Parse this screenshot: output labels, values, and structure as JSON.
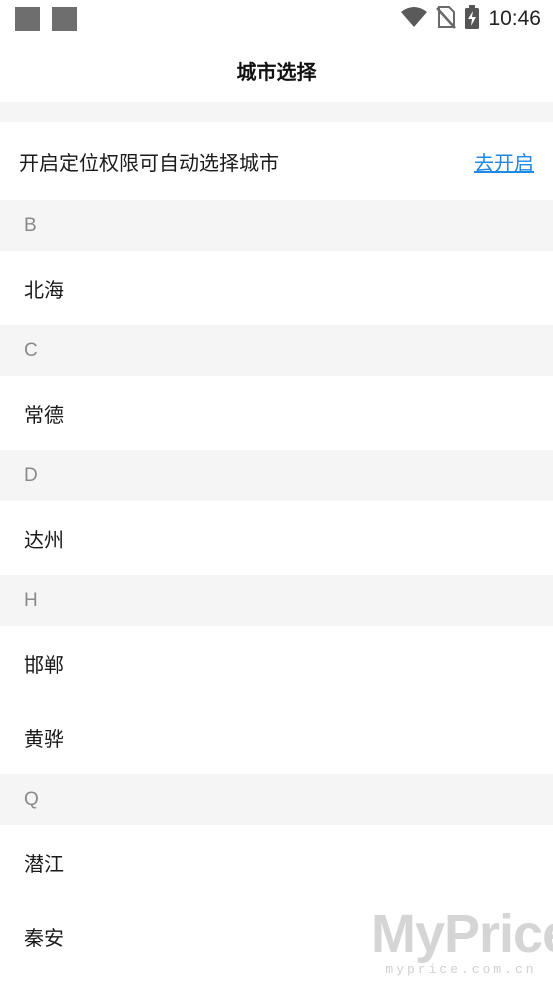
{
  "status_bar": {
    "time": "10:46",
    "icons": [
      "notification-square-icon",
      "notification-square-icon",
      "wifi-icon",
      "no-sim-icon",
      "battery-charging-icon"
    ]
  },
  "header": {
    "title": "城市选择"
  },
  "location_prompt": {
    "text": "开启定位权限可自动选择城市",
    "link_label": "去开启"
  },
  "sections": [
    {
      "letter": "B",
      "cities": [
        "北海"
      ]
    },
    {
      "letter": "C",
      "cities": [
        "常德"
      ]
    },
    {
      "letter": "D",
      "cities": [
        "达州"
      ]
    },
    {
      "letter": "H",
      "cities": [
        "邯郸",
        "黄骅"
      ]
    },
    {
      "letter": "Q",
      "cities": [
        "潜江",
        "秦安"
      ]
    }
  ],
  "watermark": {
    "brand": "MyPrice",
    "url": "myprice.com.cn"
  },
  "colors": {
    "link": "#1e88e5",
    "section_bg": "#f5f5f5",
    "section_text": "#8a8a8a"
  }
}
